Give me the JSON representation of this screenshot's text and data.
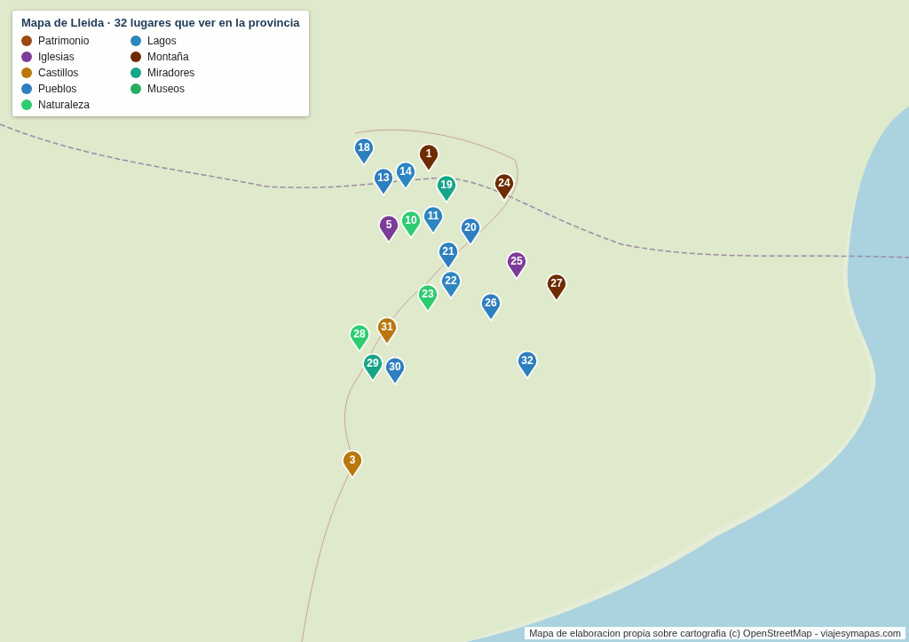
{
  "legend": {
    "title": "Mapa de Lleida · 32 lugares que ver en la provincia",
    "items": [
      {
        "label": "Patrimonio",
        "color": "#9c4a12"
      },
      {
        "label": "Iglesias",
        "color": "#7d3c98"
      },
      {
        "label": "Castillos",
        "color": "#b9770e"
      },
      {
        "label": "Pueblos",
        "color": "#2e7fbf"
      },
      {
        "label": "Naturaleza",
        "color": "#2ecc71"
      },
      {
        "label": "Lagos",
        "color": "#2e86c1"
      },
      {
        "label": "Montaña",
        "color": "#6e2c00"
      },
      {
        "label": "Miradores",
        "color": "#17a589"
      },
      {
        "label": "Museos",
        "color": "#27ae60"
      }
    ]
  },
  "markers": [
    {
      "label": "18",
      "color": "#2e7fbf"
    },
    {
      "label": "13",
      "color": "#2e7fbf"
    },
    {
      "label": "14",
      "color": "#2e86c1"
    },
    {
      "label": "1",
      "color": "#6e2c00"
    },
    {
      "label": "19",
      "color": "#17a589"
    },
    {
      "label": "11",
      "color": "#2e86c1"
    },
    {
      "label": "5",
      "color": "#7d3c98"
    },
    {
      "label": "10",
      "color": "#2ecc71"
    },
    {
      "label": "24",
      "color": "#6e2c00"
    },
    {
      "label": "20",
      "color": "#2e7fbf"
    },
    {
      "label": "21",
      "color": "#2e7fbf"
    },
    {
      "label": "22",
      "color": "#2e86c1"
    },
    {
      "label": "23",
      "color": "#2ecc71"
    },
    {
      "label": "25",
      "color": "#7d3c98"
    },
    {
      "label": "27",
      "color": "#6e2c00"
    },
    {
      "label": "26",
      "color": "#2e7fbf"
    },
    {
      "label": "31",
      "color": "#b9770e"
    },
    {
      "label": "28",
      "color": "#2ecc71"
    },
    {
      "label": "29",
      "color": "#17a589"
    },
    {
      "label": "30",
      "color": "#2e7fbf"
    },
    {
      "label": "32",
      "color": "#2e7fbf"
    },
    {
      "label": "3",
      "color": "#b9770e"
    }
  ],
  "attribution": "Mapa de elaboracion propia sobre cartografia (c) OpenStreetMap - viajesymapas.com"
}
